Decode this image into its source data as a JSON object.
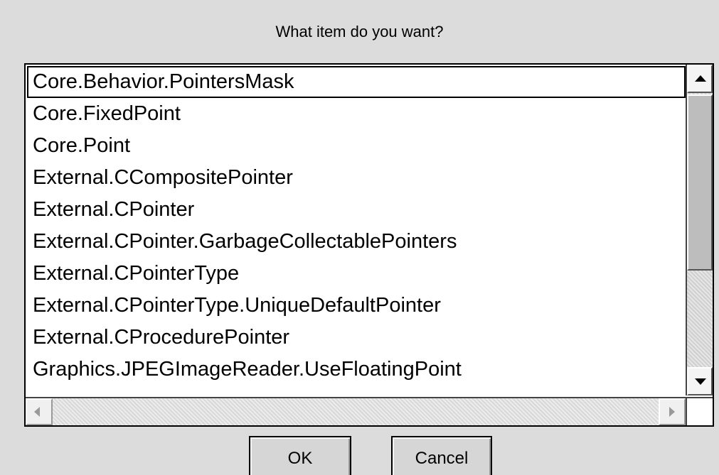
{
  "dialog": {
    "prompt": "What item do you want?",
    "items": [
      "Core.Behavior.PointersMask",
      "Core.FixedPoint",
      "Core.Point",
      "External.CCompositePointer",
      "External.CPointer",
      "External.CPointer.GarbageCollectablePointers",
      "External.CPointerType",
      "External.CPointerType.UniqueDefaultPointer",
      "External.CProcedurePointer",
      "Graphics.JPEGImageReader.UseFloatingPoint"
    ],
    "selected_index": 0,
    "ok_label": "OK",
    "cancel_label": "Cancel"
  },
  "icons": {
    "scroll_up": "arrow-up-icon",
    "scroll_down": "arrow-down-icon",
    "scroll_left": "arrow-left-icon",
    "scroll_right": "arrow-right-icon"
  },
  "colors": {
    "background": "#dcdcdc",
    "list_background": "#ffffff",
    "text": "#000000"
  }
}
